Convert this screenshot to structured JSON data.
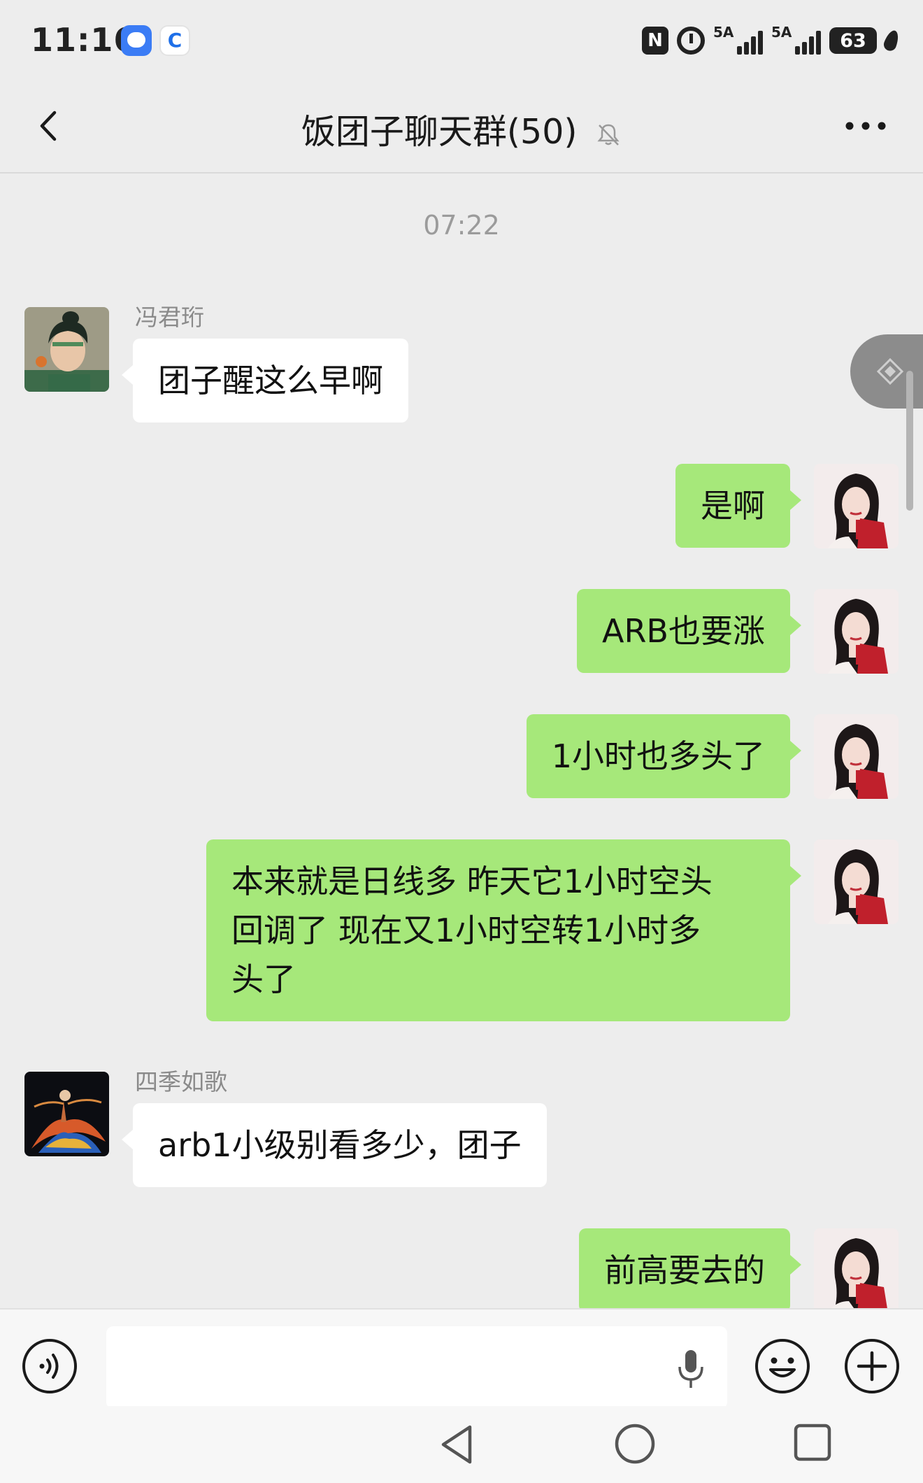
{
  "status_bar": {
    "time": "11:16",
    "nfc_label": "N",
    "signal1_label": "5A",
    "signal2_label": "5A",
    "battery": "63"
  },
  "header": {
    "title": "饭团子聊天群(50)"
  },
  "chat": {
    "timestamp": "07:22",
    "messages": [
      {
        "sender": "冯君珩",
        "text": "团子醒这么早啊",
        "direction": "in"
      },
      {
        "text": "是啊",
        "direction": "out"
      },
      {
        "text": "ARB也要涨",
        "direction": "out"
      },
      {
        "text": "1小时也多头了",
        "direction": "out"
      },
      {
        "text_lines": [
          "本来就是日线多  昨天它1小时空头",
          "回调了  现在又1小时空转1小时多",
          "头了"
        ],
        "direction": "out"
      },
      {
        "sender": "四季如歌",
        "text": "arb1小级别看多少，团子",
        "direction": "in"
      },
      {
        "text": "前高要去的",
        "direction": "out"
      }
    ]
  },
  "input_bar": {
    "placeholder": ""
  },
  "colors": {
    "background": "#ededed",
    "bubble_out": "#a6e87a",
    "bubble_in": "#ffffff"
  },
  "icons": [
    "back-icon",
    "mute-bell-icon",
    "more-icon",
    "voice-icon",
    "mic-icon",
    "emoji-icon",
    "plus-icon",
    "nav-back-icon",
    "nav-home-icon",
    "nav-recent-icon"
  ]
}
